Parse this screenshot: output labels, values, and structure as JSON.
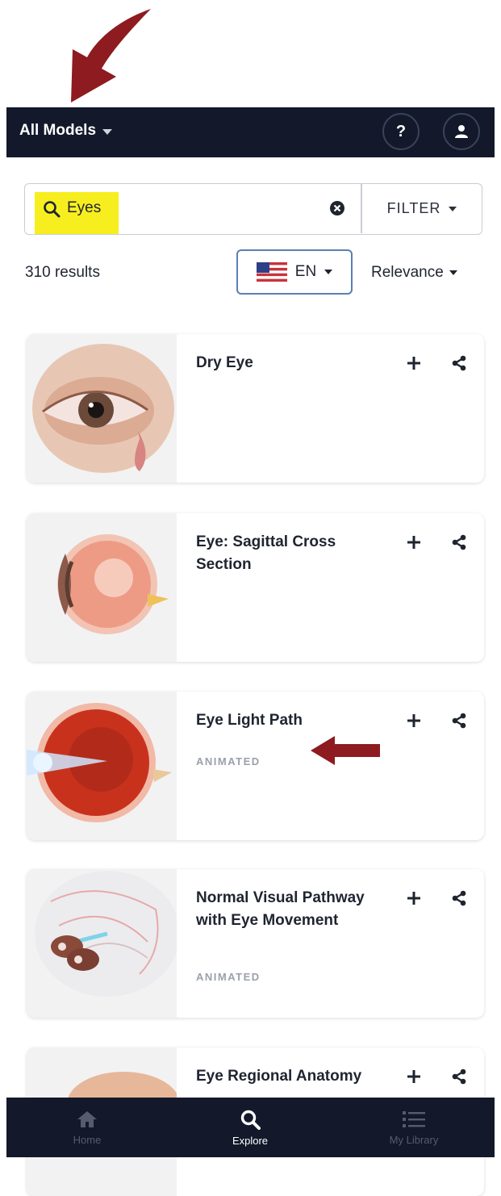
{
  "header": {
    "title": "All Models"
  },
  "search": {
    "query": "Eyes",
    "filter_label": "FILTER"
  },
  "results_bar": {
    "count_text": "310 results",
    "language": "EN",
    "sort_label": "Relevance"
  },
  "cards": [
    {
      "title": "Dry Eye",
      "badge": ""
    },
    {
      "title": "Eye: Sagittal Cross Section",
      "badge": ""
    },
    {
      "title": "Eye Light Path",
      "badge": "ANIMATED"
    },
    {
      "title": "Normal Visual Pathway with Eye Movement",
      "badge": "ANIMATED"
    },
    {
      "title": "Eye Regional Anatomy",
      "badge": ""
    }
  ],
  "bottom_nav": {
    "home": "Home",
    "explore": "Explore",
    "library": "My Library"
  },
  "colors": {
    "nav_bg": "#13192b",
    "highlight": "#f7ee1f",
    "annotation_arrow": "#8e1b1f",
    "lang_border": "#5b7fb2"
  }
}
